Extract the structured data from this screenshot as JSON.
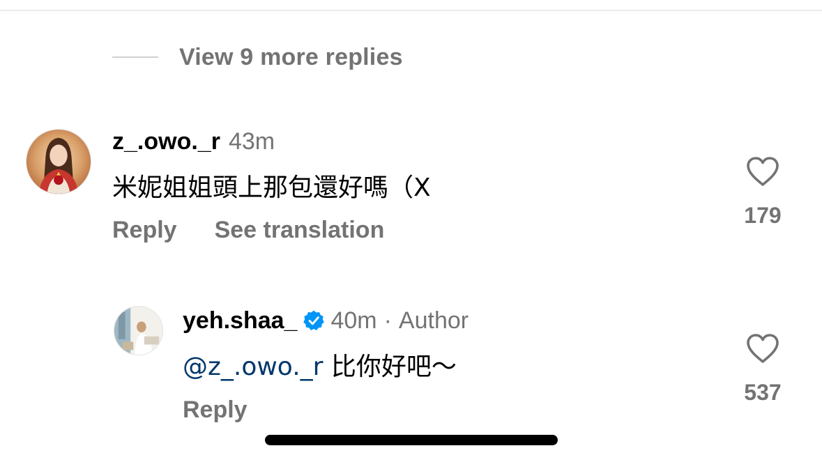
{
  "view_more_replies": {
    "label": "View 9 more replies"
  },
  "comments": [
    {
      "username": "z_.owo._r",
      "timestamp": "43m",
      "text": "米妮姐姐頭上那包還好嗎（X",
      "actions": {
        "reply": "Reply",
        "see_translation": "See translation"
      },
      "likes": "179"
    },
    {
      "username": "yeh.shaa_",
      "verified": true,
      "timestamp": "40m",
      "separator": "·",
      "author_tag": "Author",
      "mention": "@z_.owo._r",
      "text": " 比你好吧～",
      "actions": {
        "reply": "Reply"
      },
      "likes": "537"
    }
  ],
  "icons": {
    "like": "heart-outline-icon",
    "verified": "verified-badge-icon"
  },
  "colors": {
    "secondary_text": "#737373",
    "mention": "#00376b",
    "verified": "#0095f6"
  }
}
